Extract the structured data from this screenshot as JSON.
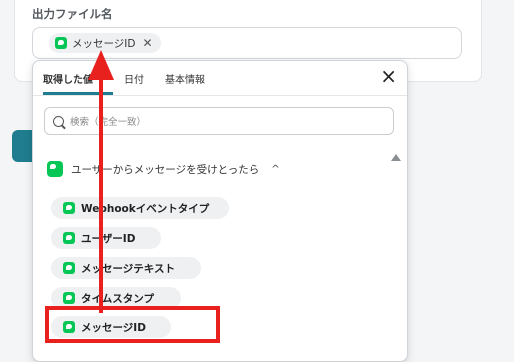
{
  "field": {
    "label": "出力ファイル名",
    "token": "メッセージID"
  },
  "dropdown": {
    "tabs": [
      "取得した値",
      "日付",
      "基本情報"
    ],
    "search_placeholder": "検索（完全一致）",
    "group_title": "ユーザーからメッセージを受けとったら",
    "items": [
      "Webhookイベントタイプ",
      "ユーザーID",
      "メッセージテキスト",
      "タイムスタンプ",
      "メッセージID"
    ]
  },
  "icons": {
    "line": "line-icon",
    "close": "close-icon",
    "search": "search-icon",
    "chevron": "chevron-up-icon"
  },
  "colors": {
    "accent": "#1f7d8f",
    "line_green": "#06c755",
    "annotation_red": "#e8211f"
  }
}
